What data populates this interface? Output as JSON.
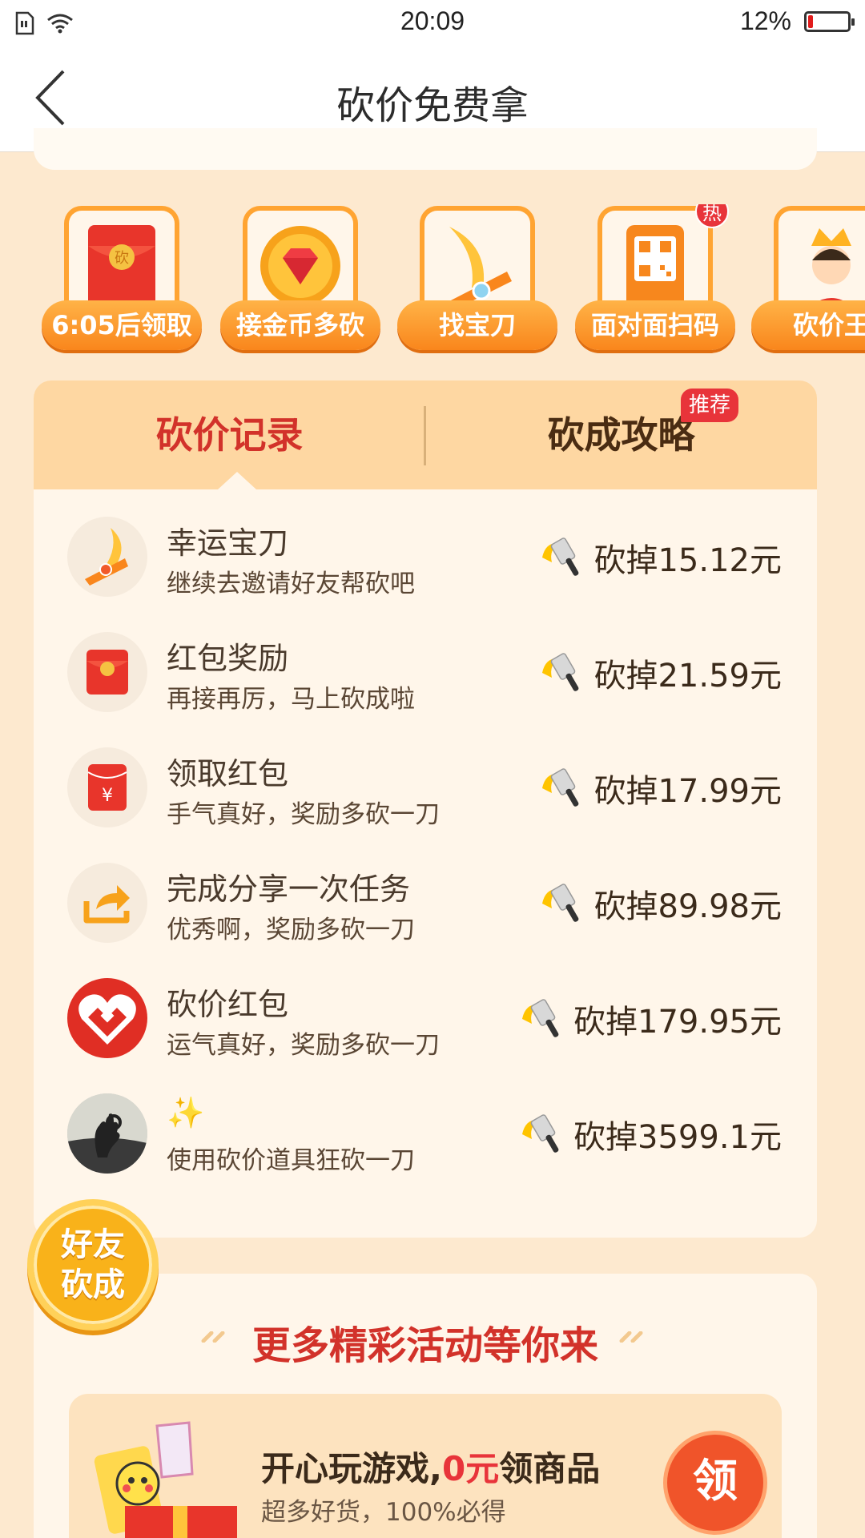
{
  "status_bar": {
    "time": "20:09",
    "battery_percent": "12%",
    "battery_level": 0.12
  },
  "nav": {
    "title": "砍价免费拿"
  },
  "shortcuts": [
    {
      "label": "6:05后领取",
      "icon": "red-envelope-icon"
    },
    {
      "label": "接金币多砍",
      "icon": "gold-coin-icon"
    },
    {
      "label": "找宝刀",
      "icon": "treasure-knife-icon"
    },
    {
      "label": "面对面扫码",
      "icon": "qr-phone-icon",
      "badge": "热"
    },
    {
      "label": "砍价王",
      "icon": "king-avatar-icon"
    }
  ],
  "tabs": {
    "records": "砍价记录",
    "guide": "砍成攻略",
    "guide_badge": "推荐"
  },
  "records": [
    {
      "title": "幸运宝刀",
      "subtitle": "继续去邀请好友帮砍吧",
      "amount": "砍掉15.12元",
      "icon": "lucky-knife-icon"
    },
    {
      "title": "红包奖励",
      "subtitle": "再接再厉，马上砍成啦",
      "amount": "砍掉21.59元",
      "icon": "red-envelope-icon"
    },
    {
      "title": "领取红包",
      "subtitle": "手气真好，奖励多砍一刀",
      "amount": "砍掉17.99元",
      "icon": "yuan-envelope-icon"
    },
    {
      "title": "完成分享一次任务",
      "subtitle": "优秀啊，奖励多砍一刀",
      "amount": "砍掉89.98元",
      "icon": "share-icon"
    },
    {
      "title": "砍价红包",
      "subtitle": "运气真好，奖励多砍一刀",
      "amount": "砍掉179.95元",
      "icon": "heart-logo-icon"
    },
    {
      "title": "✨",
      "subtitle": "使用砍价道具狂砍一刀",
      "amount": "砍掉3599.1元",
      "icon": "user-avatar-icon"
    }
  ],
  "float_button": {
    "line1": "好友",
    "line2": "砍成"
  },
  "more": {
    "title": "更多精彩活动等你来",
    "promo_title_a": "开心玩游戏,",
    "promo_title_zero": "0元",
    "promo_title_b": "领商品",
    "promo_subtitle": "超多好货，100%必得",
    "promo_button": "领"
  }
}
